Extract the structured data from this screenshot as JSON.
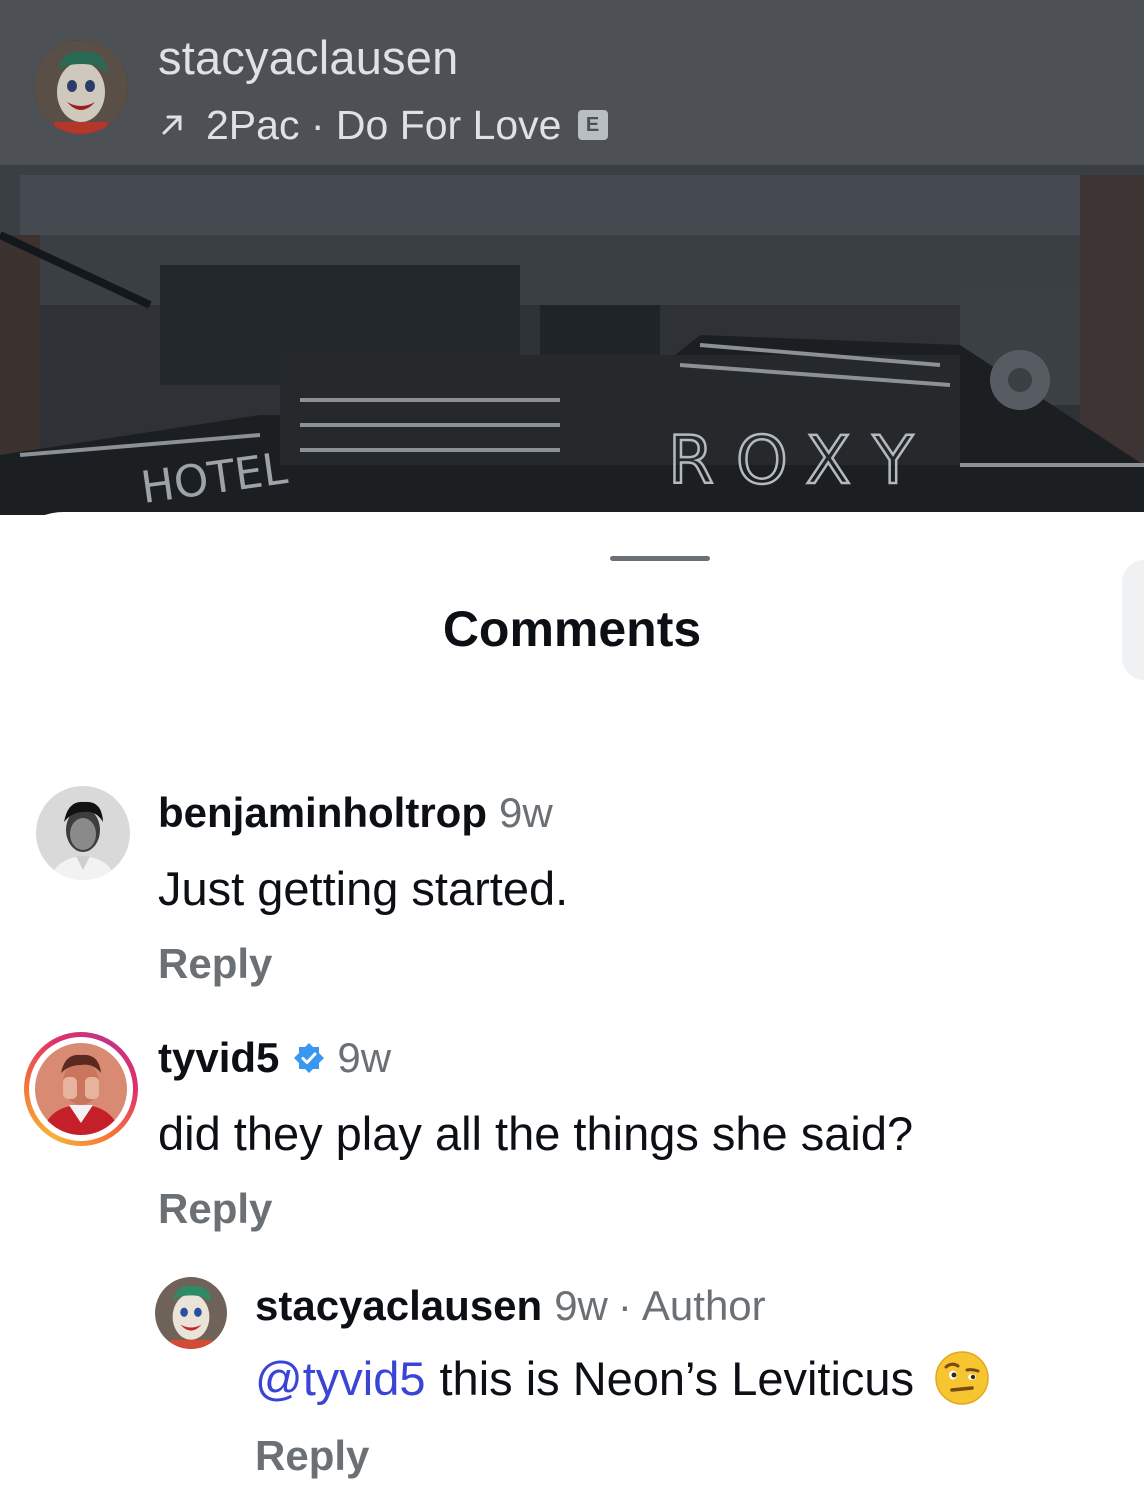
{
  "post": {
    "username": "stacyaclausen",
    "music": "2Pac · Do For Love",
    "explicit_badge": "E",
    "photo_sign_hotel": "HOTEL",
    "photo_sign_name": "ROXY"
  },
  "sheet": {
    "title": "Comments"
  },
  "comments": [
    {
      "username": "benjaminholtrop",
      "time": "9w",
      "text": "Just getting started.",
      "reply_label": "Reply"
    },
    {
      "username": "tyvid5",
      "time": "9w",
      "text": "did they play all the things she said?",
      "reply_label": "Reply",
      "verified": true,
      "has_story": true
    }
  ],
  "reply": {
    "username": "stacyaclausen",
    "time": "9w",
    "separator": "·",
    "author_label": "Author",
    "mention": "@tyvid5",
    "text": "this is Neon’s Leviticus",
    "emoji": "face-with-raised-eyebrow",
    "reply_label": "Reply"
  },
  "colors": {
    "mention": "#3a45d6",
    "verified": "#3897f0",
    "secondary_text": "#6b7075"
  }
}
